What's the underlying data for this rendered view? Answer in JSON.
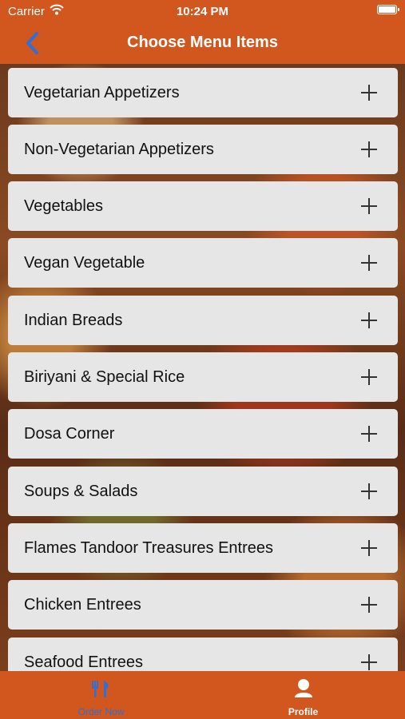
{
  "status": {
    "carrier": "Carrier",
    "time": "10:24 PM"
  },
  "nav": {
    "title": "Choose Menu Items",
    "back_icon": "chevron-left-icon"
  },
  "menu_items": [
    {
      "label": "Vegetarian Appetizers"
    },
    {
      "label": "Non-Vegetarian Appetizers"
    },
    {
      "label": "Vegetables"
    },
    {
      "label": "Vegan Vegetable"
    },
    {
      "label": "Indian Breads"
    },
    {
      "label": "Biriyani & Special Rice"
    },
    {
      "label": "Dosa Corner"
    },
    {
      "label": "Soups & Salads"
    },
    {
      "label": "Flames Tandoor Treasures Entrees"
    },
    {
      "label": "Chicken Entrees"
    },
    {
      "label": "Seafood Entrees"
    }
  ],
  "tabs": [
    {
      "label": "Order Now",
      "icon": "utensils-icon",
      "selected": true
    },
    {
      "label": "Profile",
      "icon": "user-icon",
      "selected": false
    }
  ],
  "colors": {
    "brand": "#d1571f",
    "row": "#e6e6e6",
    "accent": "#2f6fd6"
  }
}
